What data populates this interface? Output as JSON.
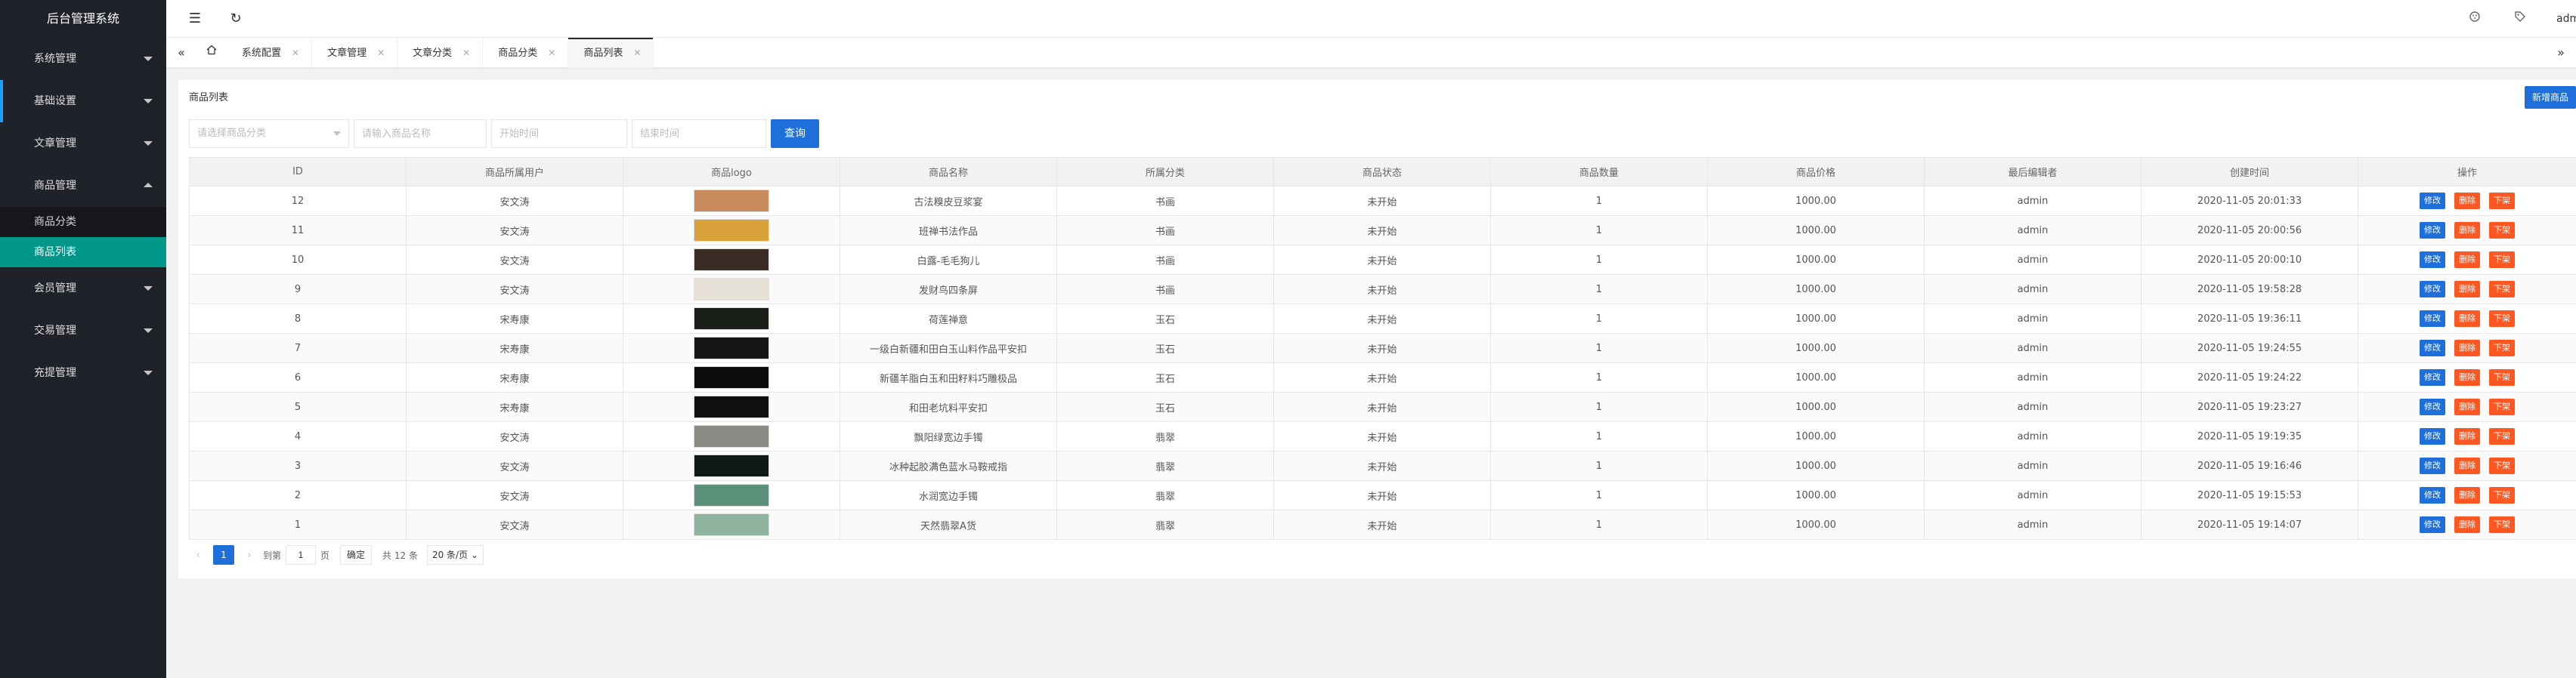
{
  "sidebar": {
    "logo": "后台管理系统",
    "items": [
      {
        "label": "系统管理"
      },
      {
        "label": "基础设置"
      },
      {
        "label": "文章管理"
      },
      {
        "label": "商品管理"
      },
      {
        "label": "会员管理"
      },
      {
        "label": "交易管理"
      },
      {
        "label": "充提管理"
      }
    ],
    "sub_items": [
      {
        "label": "商品分类"
      },
      {
        "label": "商品列表"
      }
    ]
  },
  "header": {
    "menu_icon": "☰",
    "refresh_icon": "↻",
    "user": "admin"
  },
  "tabs": [
    {
      "label": "系统配置"
    },
    {
      "label": "文章管理"
    },
    {
      "label": "文章分类"
    },
    {
      "label": "商品分类"
    },
    {
      "label": "商品列表"
    }
  ],
  "panel": {
    "title": "商品列表",
    "add_button": "新增商品"
  },
  "filters": {
    "category_placeholder": "请选择商品分类",
    "name_placeholder": "请输入商品名称",
    "start_placeholder": "开始时间",
    "end_placeholder": "结束时间",
    "query_button": "查询"
  },
  "table": {
    "headers": [
      "ID",
      "商品所属用户",
      "商品logo",
      "商品名称",
      "所属分类",
      "商品状态",
      "商品数量",
      "商品价格",
      "最后编辑者",
      "创建时间",
      "操作"
    ],
    "rows": [
      {
        "id": "12",
        "user": "安文涛",
        "name": "古法糗皮豆浆宴",
        "category": "书画",
        "status": "未开始",
        "qty": "1",
        "price": "1000.00",
        "editor": "admin",
        "created": "2020-11-05 20:01:33",
        "thumb_color": "#c98b5c"
      },
      {
        "id": "11",
        "user": "安文涛",
        "name": "班禅书法作品",
        "category": "书画",
        "status": "未开始",
        "qty": "1",
        "price": "1000.00",
        "editor": "admin",
        "created": "2020-11-05 20:00:56",
        "thumb_color": "#d9a23a"
      },
      {
        "id": "10",
        "user": "安文涛",
        "name": "白露-毛毛狗儿",
        "category": "书画",
        "status": "未开始",
        "qty": "1",
        "price": "1000.00",
        "editor": "admin",
        "created": "2020-11-05 20:00:10",
        "thumb_color": "#3a2c25"
      },
      {
        "id": "9",
        "user": "安文涛",
        "name": "发财鸟四条屏",
        "category": "书画",
        "status": "未开始",
        "qty": "1",
        "price": "1000.00",
        "editor": "admin",
        "created": "2020-11-05 19:58:28",
        "thumb_color": "#e8e1d6"
      },
      {
        "id": "8",
        "user": "宋寿康",
        "name": "荷莲禅意",
        "category": "玉石",
        "status": "未开始",
        "qty": "1",
        "price": "1000.00",
        "editor": "admin",
        "created": "2020-11-05 19:36:11",
        "thumb_color": "#1a1f1a"
      },
      {
        "id": "7",
        "user": "宋寿康",
        "name": "一级白新疆和田白玉山料作品平安扣",
        "category": "玉石",
        "status": "未开始",
        "qty": "1",
        "price": "1000.00",
        "editor": "admin",
        "created": "2020-11-05 19:24:55",
        "thumb_color": "#151515"
      },
      {
        "id": "6",
        "user": "宋寿康",
        "name": "新疆羊脂白玉和田籽料巧雕极品",
        "category": "玉石",
        "status": "未开始",
        "qty": "1",
        "price": "1000.00",
        "editor": "admin",
        "created": "2020-11-05 19:24:22",
        "thumb_color": "#0d0d0d"
      },
      {
        "id": "5",
        "user": "宋寿康",
        "name": "和田老坑料平安扣",
        "category": "玉石",
        "status": "未开始",
        "qty": "1",
        "price": "1000.00",
        "editor": "admin",
        "created": "2020-11-05 19:23:27",
        "thumb_color": "#111111"
      },
      {
        "id": "4",
        "user": "安文涛",
        "name": "飘阳绿宽边手镯",
        "category": "翡翠",
        "status": "未开始",
        "qty": "1",
        "price": "1000.00",
        "editor": "admin",
        "created": "2020-11-05 19:19:35",
        "thumb_color": "#8a8a84"
      },
      {
        "id": "3",
        "user": "安文涛",
        "name": "冰种起胶满色蓝水马鞍戒指",
        "category": "翡翠",
        "status": "未开始",
        "qty": "1",
        "price": "1000.00",
        "editor": "admin",
        "created": "2020-11-05 19:16:46",
        "thumb_color": "#0f1a16"
      },
      {
        "id": "2",
        "user": "安文涛",
        "name": "水润宽边手镯",
        "category": "翡翠",
        "status": "未开始",
        "qty": "1",
        "price": "1000.00",
        "editor": "admin",
        "created": "2020-11-05 19:15:53",
        "thumb_color": "#5a8f7a"
      },
      {
        "id": "1",
        "user": "安文涛",
        "name": "天然翡翠A货",
        "category": "翡翠",
        "status": "未开始",
        "qty": "1",
        "price": "1000.00",
        "editor": "admin",
        "created": "2020-11-05 19:14:07",
        "thumb_color": "#8fb5a0"
      }
    ],
    "ops": {
      "edit": "修改",
      "delete": "删除",
      "off": "下架"
    }
  },
  "pager": {
    "prev": "‹",
    "current": "1",
    "next": "›",
    "goto_label": "到第",
    "goto_value": "1",
    "page_unit": "页",
    "confirm": "确定",
    "total": "共 12 条",
    "size": "20 条/页"
  },
  "colors": {
    "sidebar_bg": "#20222a",
    "active_sub": "#009688",
    "primary": "#1e6fd9",
    "danger": "#ff5722"
  }
}
